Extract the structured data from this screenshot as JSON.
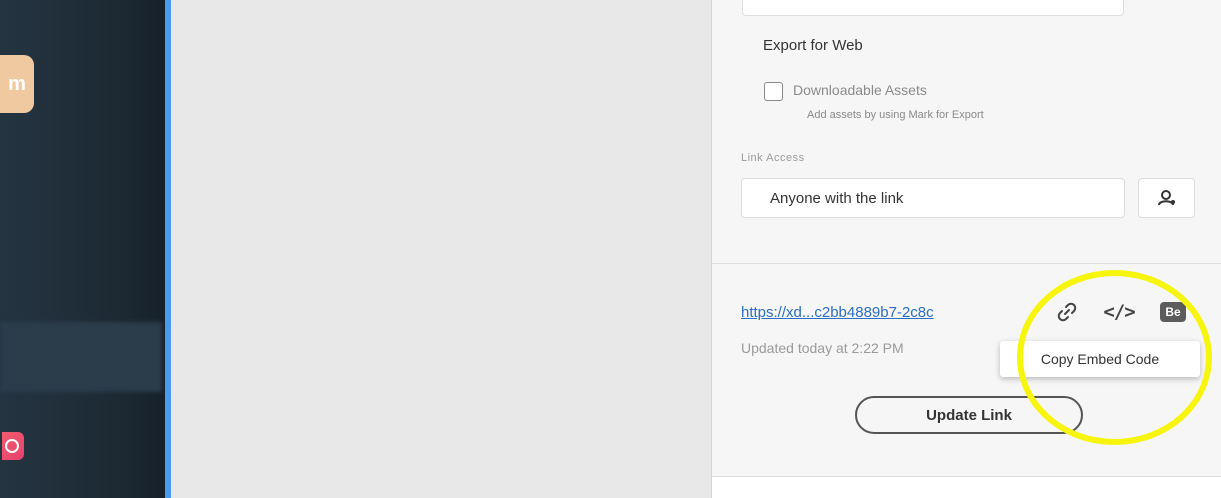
{
  "sidebar": {
    "app_icon_letter": "m"
  },
  "panel": {
    "export_title": "Export for Web",
    "downloadable_assets_label": "Downloadable Assets",
    "downloadable_assets_hint": "Add assets by using Mark for Export",
    "downloadable_assets_checked": false,
    "link_access_label": "Link Access",
    "link_access_value": "Anyone with the link",
    "share_url": "https://xd...c2bb4889b7-2c8c",
    "updated_text": "Updated today at 2:22 PM",
    "tooltip_text": "Copy Embed Code",
    "embed_icon_text": "</>",
    "behance_icon_text": "Be",
    "update_button_label": "Update Link"
  },
  "colors": {
    "link": "#2a6ec7",
    "highlight": "#f7f40d",
    "sidebar_edge": "#4a9bf0",
    "sidebar_bg": "#1e2a35"
  },
  "icons": [
    "user-icon",
    "link-icon",
    "embed-code-icon",
    "behance-icon",
    "instagram-icon"
  ]
}
